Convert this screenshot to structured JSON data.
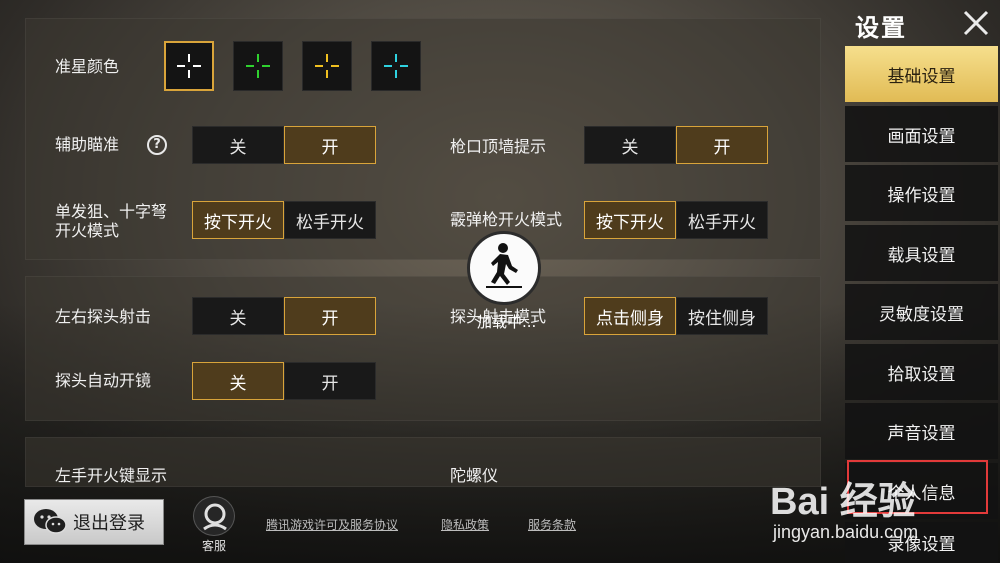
{
  "settings": {
    "crosshair_color_label": "准星颜色",
    "crosshair_colors": [
      "#ffffff",
      "#2fd12f",
      "#f0c020",
      "#2fd2e0"
    ],
    "aim_assist": {
      "label": "辅助瞄准",
      "off": "关",
      "on": "开"
    },
    "muzzle_wall_hint": {
      "label": "枪口顶墙提示",
      "off": "关",
      "on": "开"
    },
    "single_shot_fire_mode": {
      "label_line1": "单发狙、十字弩",
      "label_line2": "开火模式",
      "press": "按下开火",
      "release": "松手开火"
    },
    "shotgun_fire_mode": {
      "label": "霰弹枪开火模式",
      "press": "按下开火",
      "release": "松手开火"
    },
    "peek_shoot": {
      "label": "左右探头射击",
      "off": "关",
      "on": "开"
    },
    "peek_mode": {
      "label": "探头射击模式",
      "tap": "点击侧身",
      "hold": "按住侧身"
    },
    "peek_auto_scope": {
      "label": "探头自动开镜",
      "off": "关",
      "on": "开"
    },
    "left_fire_button": {
      "label": "左手开火键显示"
    },
    "gyroscope": {
      "label": "陀螺仪"
    }
  },
  "loading": {
    "text": "加载中..."
  },
  "sidebar": {
    "title": "设置",
    "items": [
      "基础设置",
      "画面设置",
      "操作设置",
      "载具设置",
      "灵敏度设置",
      "拾取设置",
      "声音设置",
      "个人信息",
      "录像设置"
    ]
  },
  "footer": {
    "logout_label": "退出登录",
    "service_label": "客服",
    "links": [
      "腾讯游戏许可及服务协议",
      "隐私政策",
      "服务条款"
    ]
  },
  "watermark": {
    "logo": "Bai 经验",
    "url": "jingyan.baidu.com"
  },
  "colors": {
    "accent": "#d9a43a",
    "active_tab": "#e9c566"
  }
}
